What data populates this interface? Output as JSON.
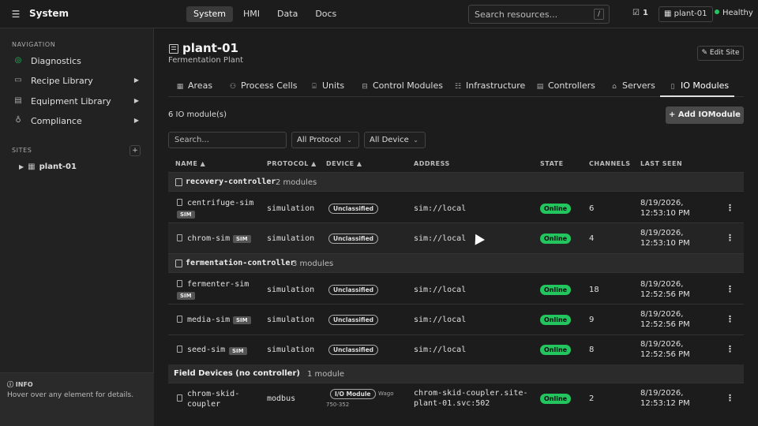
{
  "app": {
    "title": "System"
  },
  "topnav": {
    "tabs": [
      "System",
      "HMI",
      "Data",
      "Docs"
    ],
    "active": "System"
  },
  "search": {
    "placeholder": "Search resources...",
    "shortcut": "/"
  },
  "status": {
    "tasks_count": "1",
    "site": "plant-01",
    "health": "Healthy",
    "health_color": "#22c55e"
  },
  "sidebar": {
    "nav_heading": "NAVIGATION",
    "items": [
      {
        "label": "Diagnostics",
        "icon": "diagnostics-icon",
        "has_arrow": false
      },
      {
        "label": "Recipe Library",
        "icon": "book-icon",
        "has_arrow": true
      },
      {
        "label": "Equipment Library",
        "icon": "equipment-icon",
        "has_arrow": true
      },
      {
        "label": "Compliance",
        "icon": "badge-icon",
        "has_arrow": true
      }
    ],
    "sites_heading": "SITES",
    "add_site": "+",
    "site": "plant-01",
    "info_title": "INFO",
    "info_text": "Hover over any element for details."
  },
  "page": {
    "title": "plant-01",
    "subtitle": "Fermentation Plant",
    "edit_button": "Edit Site",
    "tabs": [
      "Areas",
      "Process Cells",
      "Units",
      "Control Modules",
      "Infrastructure",
      "Controllers",
      "Servers",
      "IO Modules"
    ],
    "active_tab": "IO Modules",
    "count_text": "6 IO module(s)",
    "add_button": "+ Add IOModule",
    "filter_placeholder": "Search...",
    "protocol_filter": "All Protocol",
    "device_filter": "All Device"
  },
  "table": {
    "columns": [
      "NAME",
      "PROTOCOL",
      "DEVICE",
      "ADDRESS",
      "STATE",
      "CHANNELS",
      "LAST SEEN"
    ],
    "groups": [
      {
        "name": "recovery-controller",
        "count": "2 modules",
        "rows": [
          {
            "name": "centrifuge-sim",
            "sim": "SIM",
            "protocol": "simulation",
            "device": "Unclassified",
            "address": "sim://local",
            "state": "Online",
            "channels": "6",
            "last_seen_1": "8/19/2026,",
            "last_seen_2": "12:53:10 PM"
          },
          {
            "name": "chrom-sim",
            "sim": "SIM",
            "protocol": "simulation",
            "device": "Unclassified",
            "address": "sim://local",
            "state": "Online",
            "channels": "4",
            "last_seen_1": "8/19/2026,",
            "last_seen_2": "12:53:10 PM"
          }
        ]
      },
      {
        "name": "fermentation-controller",
        "count": "3 modules",
        "rows": [
          {
            "name": "fermenter-sim",
            "sim": "SIM",
            "protocol": "simulation",
            "device": "Unclassified",
            "address": "sim://local",
            "state": "Online",
            "channels": "18",
            "last_seen_1": "8/19/2026,",
            "last_seen_2": "12:52:56 PM"
          },
          {
            "name": "media-sim",
            "sim": "SIM",
            "protocol": "simulation",
            "device": "Unclassified",
            "address": "sim://local",
            "state": "Online",
            "channels": "9",
            "last_seen_1": "8/19/2026,",
            "last_seen_2": "12:52:56 PM"
          },
          {
            "name": "seed-sim",
            "sim": "SIM",
            "protocol": "simulation",
            "device": "Unclassified",
            "address": "sim://local",
            "state": "Online",
            "channels": "8",
            "last_seen_1": "8/19/2026,",
            "last_seen_2": "12:52:56 PM"
          }
        ]
      },
      {
        "name": "Field Devices (no controller)",
        "count": "1 module",
        "rows": [
          {
            "name_1": "chrom-skid-",
            "name_2": "coupler",
            "protocol": "modbus",
            "device": "I/O Module",
            "vendor": "Wago",
            "model": "750-352",
            "address_1": "chrom-skid-coupler.site-",
            "address_2": "plant-01.svc:502",
            "state": "Online",
            "channels": "2",
            "last_seen_1": "8/19/2026,",
            "last_seen_2": "12:53:12 PM"
          }
        ]
      }
    ]
  },
  "colors": {
    "online": "#22c55e",
    "background": "#1c1c1c",
    "sidebar": "#222222"
  }
}
